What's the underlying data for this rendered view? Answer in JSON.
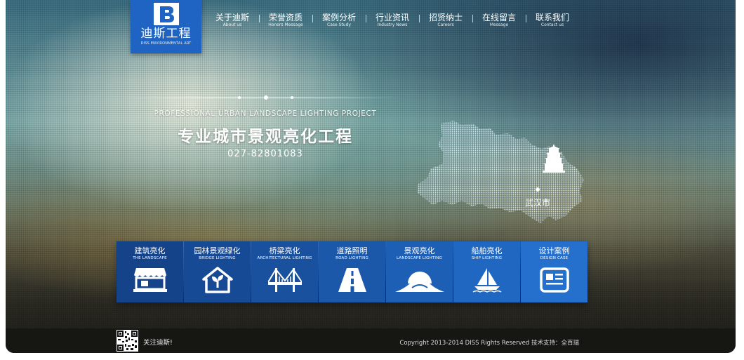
{
  "brand": {
    "name_cn": "迪斯工程",
    "name_en": "DISS ENVIRONMENTAL ART",
    "primary_color": "#1f64c3"
  },
  "nav": {
    "items": [
      {
        "cn": "关于迪斯",
        "en": "About us"
      },
      {
        "cn": "荣誉资质",
        "en": "Honors Message"
      },
      {
        "cn": "案例分析",
        "en": "Case Study"
      },
      {
        "cn": "行业资讯",
        "en": "Industry News"
      },
      {
        "cn": "招贤纳士",
        "en": "Careers"
      },
      {
        "cn": "在线留言",
        "en": "Message"
      },
      {
        "cn": "联系我们",
        "en": "Contact us"
      }
    ]
  },
  "hero": {
    "subtitle_en": "Professional urban landscape lighting project",
    "title_cn": "专业城市景观亮化工程",
    "phone": "027-82801083",
    "map_city": "武汉市"
  },
  "tiles": [
    {
      "cn": "建筑亮化",
      "en": "THE LANDSCAPE",
      "icon": "shop-icon",
      "color": "#15438a"
    },
    {
      "cn": "园林景观绿化",
      "en": "BRIDGE LIGHTING",
      "icon": "house-plant-icon",
      "color": "#174a95"
    },
    {
      "cn": "桥梁亮化",
      "en": "ARCHITECTURAL LIGHTING",
      "icon": "bridge-icon",
      "color": "#19519f"
    },
    {
      "cn": "道路照明",
      "en": "ROAD LIGHTING",
      "icon": "road-icon",
      "color": "#1b58aa"
    },
    {
      "cn": "景观亮化",
      "en": "LANDSCAPE LIGHTING",
      "icon": "mountain-sun-icon",
      "color": "#1d5fb5"
    },
    {
      "cn": "船舶亮化",
      "en": "SHIP LIGHTING",
      "icon": "sailboat-icon",
      "color": "#1f67c0"
    },
    {
      "cn": "设计案例",
      "en": "DESIGN CASE",
      "icon": "newspaper-icon",
      "color": "#2470cc"
    }
  ],
  "footer": {
    "follow_text": "关注迪斯!",
    "copyright": "Copyright 2013-2014 DISS Rights Reserved  技术支持：全百瑞"
  }
}
